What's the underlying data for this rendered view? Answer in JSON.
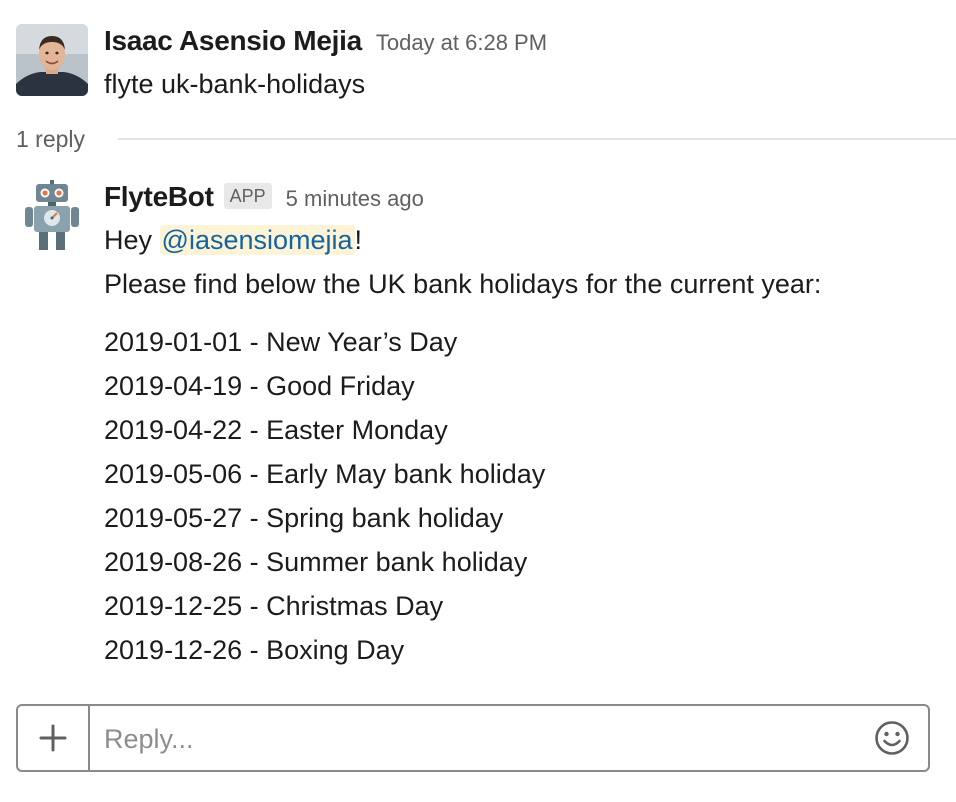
{
  "thread": {
    "parent": {
      "author": "Isaac Asensio Mejia",
      "timestamp": "Today at 6:28 PM",
      "text": "flyte uk-bank-holidays",
      "avatar_icon": "user-photo-avatar"
    },
    "reply_count_label": "1 reply",
    "reply": {
      "author": "FlyteBot",
      "badge": "APP",
      "timestamp": "5 minutes ago",
      "avatar_icon": "robot-avatar",
      "greeting_prefix": "Hey ",
      "mention": "@iasensiomejia",
      "greeting_suffix": "!",
      "intro": "Please find below the UK bank holidays for the current year:",
      "holidays": [
        "2019-01-01 - New Year’s Day",
        "2019-04-19 - Good Friday",
        "2019-04-22 - Easter Monday",
        "2019-05-06 - Early May bank holiday",
        "2019-05-27 - Spring bank holiday",
        "2019-08-26 - Summer bank holiday",
        "2019-12-25 - Christmas Day",
        "2019-12-26 - Boxing Day"
      ]
    }
  },
  "composer": {
    "placeholder": "Reply...",
    "value": "",
    "add_icon": "plus-icon",
    "emoji_icon": "smiley-icon"
  },
  "colors": {
    "mention_text": "#1264a3",
    "mention_bg": "#fdf3d6",
    "muted_text": "#616061",
    "border": "#8a8a8a"
  }
}
